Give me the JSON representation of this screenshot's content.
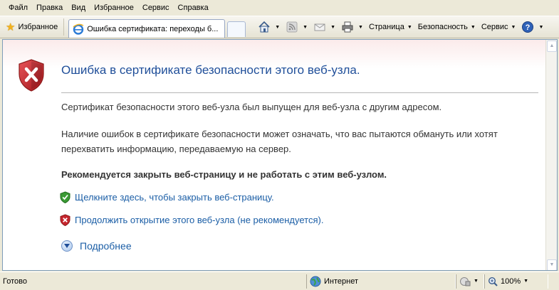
{
  "menu": [
    "Файл",
    "Правка",
    "Вид",
    "Избранное",
    "Сервис",
    "Справка"
  ],
  "toolbar": {
    "favorites_label": "Избранное",
    "tab_title": "Ошибка сертификата: переходы б...",
    "page_label": "Страница",
    "security_label": "Безопасность",
    "tools_label": "Сервис"
  },
  "page": {
    "title": "Ошибка в сертификате безопасности этого веб-узла.",
    "para1": "Сертификат безопасности этого веб-узла был выпущен для веб-узла с другим адресом.",
    "para2_line1": "Наличие ошибок в сертификате безопасности может означать, что вас пытаются обмануть или хотят",
    "para2_line2": "перехватить информацию, передаваемую на сервер.",
    "recommendation": "Рекомендуется закрыть веб-страницу и не работать с этим веб-узлом.",
    "close_link": "Щелкните здесь, чтобы закрыть веб-страницу.",
    "continue_link": "Продолжить открытие этого веб-узла (не рекомендуется).",
    "more_info": "Подробнее"
  },
  "status": {
    "text": "Готово",
    "zone": "Интернет",
    "zoom": "100%"
  },
  "colors": {
    "title": "#1f4e99",
    "link": "#1b5ea6",
    "shield_red": "#c6262e",
    "shield_green": "#3b9b35"
  }
}
